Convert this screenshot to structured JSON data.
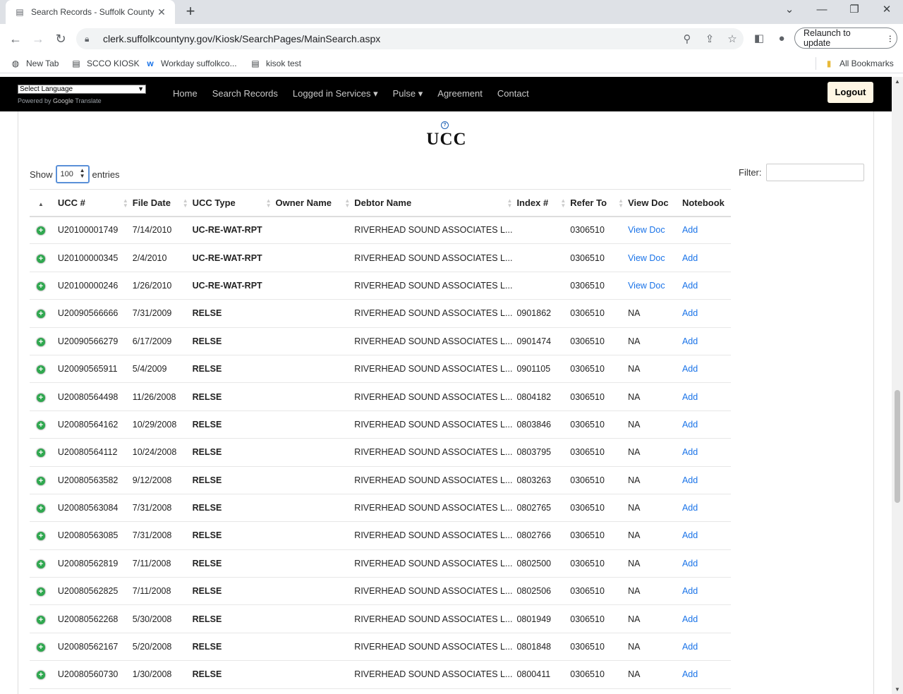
{
  "browser": {
    "tab_title": "Search Records - Suffolk County",
    "url": "clerk.suffolkcountyny.gov/Kiosk/SearchPages/MainSearch.aspx",
    "relaunch_label": "Relaunch to update",
    "bookmarks": [
      "New Tab",
      "SCCO KIOSK",
      "Workday suffolkco...",
      "kisok test"
    ],
    "all_bookmarks": "All Bookmarks"
  },
  "site": {
    "language_select": "Select Language",
    "powered_by": "Powered by",
    "translate_brand": "Google",
    "translate_word": "Translate",
    "nav": [
      "Home",
      "Search Records",
      "Logged in Services ▾",
      "Pulse ▾",
      "Agreement",
      "Contact"
    ],
    "logout": "Logout"
  },
  "content": {
    "title": "UCC",
    "show_label": "Show",
    "page_size": "100",
    "entries_label": "entries",
    "filter_label": "Filter:",
    "columns": [
      "UCC #",
      "File Date",
      "UCC Type",
      "Owner Name",
      "Debtor Name",
      "Index #",
      "Refer To",
      "View Doc",
      "Notebook"
    ],
    "rows": [
      [
        "U20100001749",
        "7/14/2010",
        "UC-RE-WAT-RPT",
        "",
        "RIVERHEAD SOUND ASSOCIATES L...",
        "",
        "0306510",
        "View Doc",
        "Add"
      ],
      [
        "U20100000345",
        "2/4/2010",
        "UC-RE-WAT-RPT",
        "",
        "RIVERHEAD SOUND ASSOCIATES L...",
        "",
        "0306510",
        "View Doc",
        "Add"
      ],
      [
        "U20100000246",
        "1/26/2010",
        "UC-RE-WAT-RPT",
        "",
        "RIVERHEAD SOUND ASSOCIATES L...",
        "",
        "0306510",
        "View Doc",
        "Add"
      ],
      [
        "U20090566666",
        "7/31/2009",
        "RELSE",
        "",
        "RIVERHEAD SOUND ASSOCIATES L...",
        "0901862",
        "0306510",
        "NA",
        "Add"
      ],
      [
        "U20090566279",
        "6/17/2009",
        "RELSE",
        "",
        "RIVERHEAD SOUND ASSOCIATES L...",
        "0901474",
        "0306510",
        "NA",
        "Add"
      ],
      [
        "U20090565911",
        "5/4/2009",
        "RELSE",
        "",
        "RIVERHEAD SOUND ASSOCIATES L...",
        "0901105",
        "0306510",
        "NA",
        "Add"
      ],
      [
        "U20080564498",
        "11/26/2008",
        "RELSE",
        "",
        "RIVERHEAD SOUND ASSOCIATES L...",
        "0804182",
        "0306510",
        "NA",
        "Add"
      ],
      [
        "U20080564162",
        "10/29/2008",
        "RELSE",
        "",
        "RIVERHEAD SOUND ASSOCIATES L...",
        "0803846",
        "0306510",
        "NA",
        "Add"
      ],
      [
        "U20080564112",
        "10/24/2008",
        "RELSE",
        "",
        "RIVERHEAD SOUND ASSOCIATES L...",
        "0803795",
        "0306510",
        "NA",
        "Add"
      ],
      [
        "U20080563582",
        "9/12/2008",
        "RELSE",
        "",
        "RIVERHEAD SOUND ASSOCIATES L...",
        "0803263",
        "0306510",
        "NA",
        "Add"
      ],
      [
        "U20080563084",
        "7/31/2008",
        "RELSE",
        "",
        "RIVERHEAD SOUND ASSOCIATES L...",
        "0802765",
        "0306510",
        "NA",
        "Add"
      ],
      [
        "U20080563085",
        "7/31/2008",
        "RELSE",
        "",
        "RIVERHEAD SOUND ASSOCIATES L...",
        "0802766",
        "0306510",
        "NA",
        "Add"
      ],
      [
        "U20080562819",
        "7/11/2008",
        "RELSE",
        "",
        "RIVERHEAD SOUND ASSOCIATES L...",
        "0802500",
        "0306510",
        "NA",
        "Add"
      ],
      [
        "U20080562825",
        "7/11/2008",
        "RELSE",
        "",
        "RIVERHEAD SOUND ASSOCIATES L...",
        "0802506",
        "0306510",
        "NA",
        "Add"
      ],
      [
        "U20080562268",
        "5/30/2008",
        "RELSE",
        "",
        "RIVERHEAD SOUND ASSOCIATES L...",
        "0801949",
        "0306510",
        "NA",
        "Add"
      ],
      [
        "U20080562167",
        "5/20/2008",
        "RELSE",
        "",
        "RIVERHEAD SOUND ASSOCIATES L...",
        "0801848",
        "0306510",
        "NA",
        "Add"
      ],
      [
        "U20080560730",
        "1/30/2008",
        "RELSE",
        "",
        "RIVERHEAD SOUND ASSOCIATES L...",
        "0800411",
        "0306510",
        "NA",
        "Add"
      ]
    ]
  }
}
